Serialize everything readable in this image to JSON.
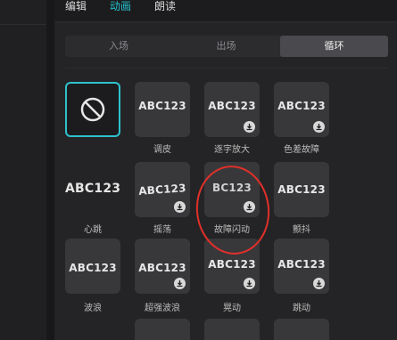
{
  "top_tabs": [
    {
      "label": "编辑"
    },
    {
      "label": "动画"
    },
    {
      "label": "朗读"
    }
  ],
  "segments": [
    {
      "label": "入场"
    },
    {
      "label": "出场"
    },
    {
      "label": "循环"
    }
  ],
  "colors": {
    "accent": "#25c2d2",
    "tile": "#38383b",
    "selected_border": "#2ec2cc",
    "annotation": "#e0302a"
  },
  "tiles": [
    {
      "preview": "",
      "label": "",
      "icon": "none-icon"
    },
    {
      "preview": "ABC123",
      "label": "调皮"
    },
    {
      "preview": "ABC123",
      "label": "逐字放大"
    },
    {
      "preview": "ABC123",
      "label": "色差故障"
    },
    {
      "preview": "ABC123",
      "label": "心跳"
    },
    {
      "preview": "ABC123",
      "label": "摇荡"
    },
    {
      "preview": "BC123",
      "label": "故障闪动"
    },
    {
      "preview": "ABC123",
      "label": "颤抖"
    },
    {
      "preview": "ABC123",
      "label": "波浪"
    },
    {
      "preview": "ABC123",
      "label": "超强波浪"
    },
    {
      "preview": "ABC123",
      "label": "晃动"
    },
    {
      "preview": "ABC123",
      "label": "跳动"
    }
  ]
}
